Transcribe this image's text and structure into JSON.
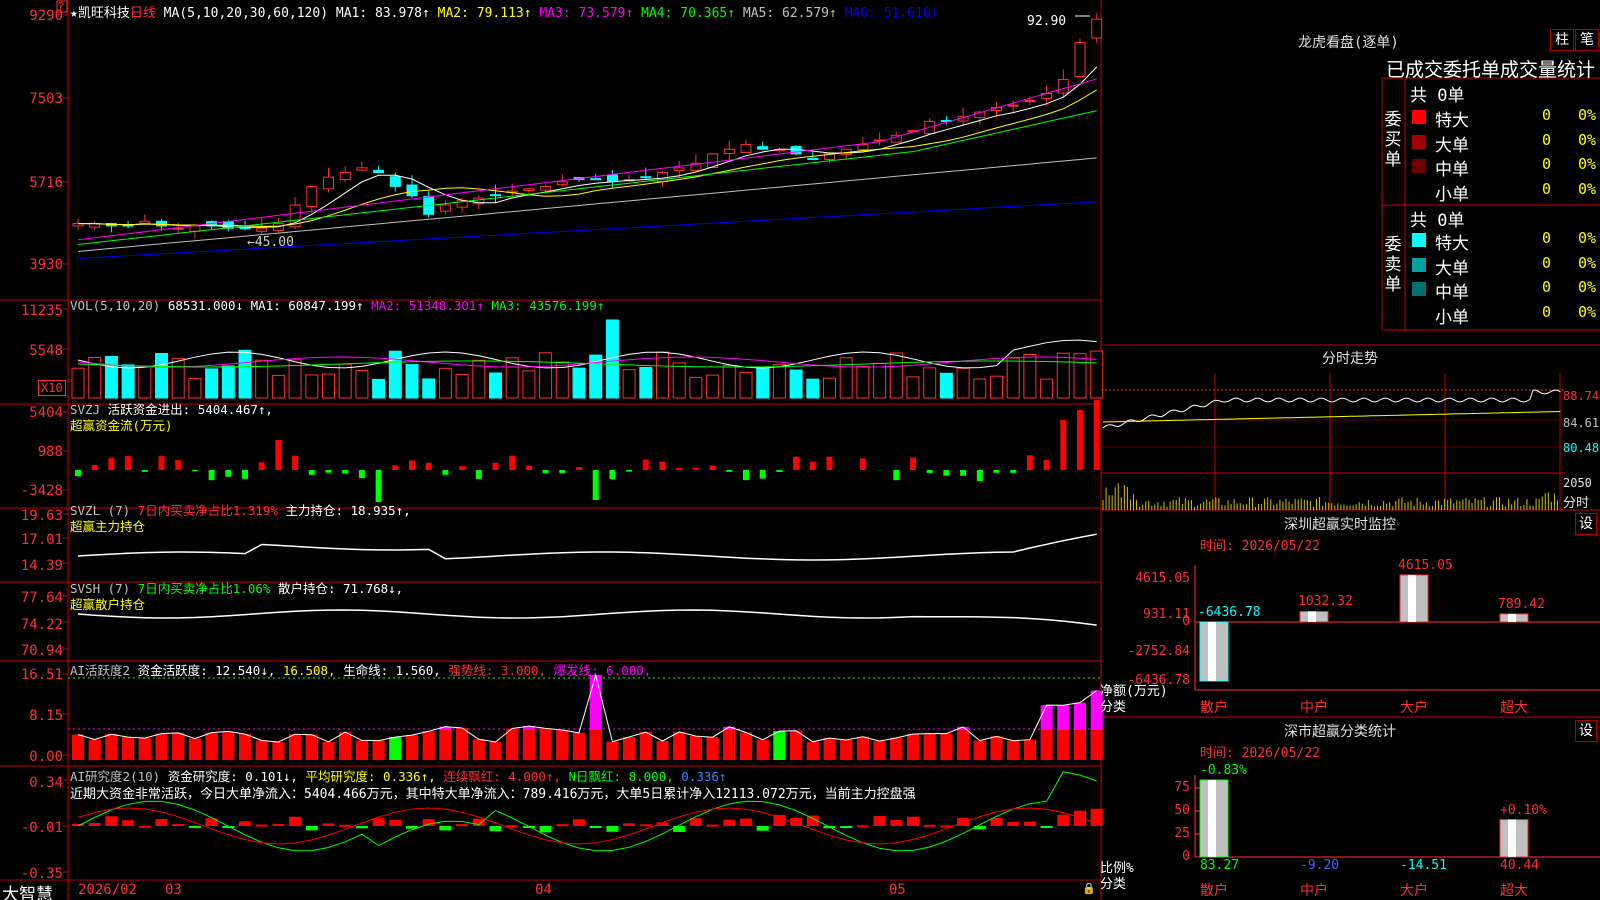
{
  "stock": {
    "title": "★凯旺科技",
    "period": "日线",
    "ma_params": "MA(5,10,20,30,60,120)",
    "ma": [
      {
        "label": "MA1: 83.978↑",
        "color": "#ffffff"
      },
      {
        "label": "MA2: 79.113↑",
        "color": "#ffff00"
      },
      {
        "label": "MA3: 73.579↑",
        "color": "#ff00ff"
      },
      {
        "label": "MA4: 70.365↑",
        "color": "#00ff00"
      },
      {
        "label": "MA5: 62.579↑",
        "color": "#c0c0c0"
      },
      {
        "label": "MA6: 51.616↑",
        "color": "#0000ff"
      }
    ],
    "high_label": "92.90",
    "low_label": "←45.00",
    "price_axis": [
      "9290",
      "7503",
      "5716",
      "3930"
    ],
    "corner_mark": "?"
  },
  "vol_panel": {
    "legend_name": "VOL(5,10,20)",
    "value": "68531.000↓",
    "ma1": "MA1: 60847.199↑",
    "ma2": "MA2: 51348.301↑",
    "ma3": "MA3: 43576.199↑",
    "axis": [
      "11235",
      "5548"
    ],
    "unit": "X10"
  },
  "svzj_panel": {
    "legend_name": "SVZJ",
    "line1": "活跃资金进出: 5404.467↑,",
    "line2": "超赢资金流(万元)",
    "axis": [
      "5404",
      "988",
      "-3428"
    ]
  },
  "svzl_panel": {
    "legend_name": "SVZL (7)",
    "ratio": "7日内买卖净占比1.319%",
    "hold": "主力持仓: 18.935↑,",
    "line2": "超赢主力持仓",
    "axis": [
      "19.63",
      "17.01",
      "14.39"
    ]
  },
  "svsh_panel": {
    "legend_name": "SVSH (7)",
    "ratio": "7日内买卖净占比1.06%",
    "hold": "散户持仓: 71.768↓,",
    "line2": "超赢散户持仓",
    "axis": [
      "77.64",
      "74.22",
      "70.94"
    ]
  },
  "ai_active_panel": {
    "legend_name": "AI活跃度2",
    "v1": "资金活跃度: 12.540↓,",
    "v2": "16.508,",
    "v3": "生命线: 1.560,",
    "v4": "强势线: 3.000,",
    "v5": "爆发线: 6.000,",
    "axis": [
      "16.51",
      "8.15",
      "0.00"
    ]
  },
  "ai_research_panel": {
    "legend_name": "AI研究度2(10)",
    "v1": "资金研究度: 0.101↓,",
    "v2": "平均研究度: 0.336↑,",
    "v3": "连续飘红: 4.000↑,",
    "v4": "N日飘红: 8.000,",
    "v5": "0.336↑",
    "comment": "近期大资金非常活跃，今日大单净流入：5404.466万元，其中特大单净流入：789.416万元，大单5日累计净入12113.072万元，当前主力控盘强",
    "axis": [
      "0.34",
      "-0.01",
      "-0.35"
    ]
  },
  "bottom_bar": {
    "brand": "大智慧",
    "dates": [
      "2026/02",
      "03",
      "04",
      "05"
    ]
  },
  "right": {
    "lhb_title": "龙虎看盘(逐单)",
    "btn_zhu": "柱",
    "btn_bi": "笔",
    "tabs_row": "已成交委托单成交量统计",
    "buy": {
      "side_label": "委买单",
      "total": "共 0单",
      "rows": [
        {
          "name": "特大",
          "count": "0",
          "pct": "0%",
          "color": "#ff0000"
        },
        {
          "name": "大单",
          "count": "0",
          "pct": "0%",
          "color": "#a00000"
        },
        {
          "name": "中单",
          "count": "0",
          "pct": "0%",
          "color": "#700000"
        },
        {
          "name": "小单",
          "count": "0",
          "pct": "0%",
          "color": "#000000"
        }
      ]
    },
    "sell": {
      "side_label": "委卖单",
      "total": "共 0单",
      "rows": [
        {
          "name": "特大",
          "count": "0",
          "pct": "0%",
          "color": "#00ffff"
        },
        {
          "name": "大单",
          "count": "0",
          "pct": "0%",
          "color": "#00a0a0"
        },
        {
          "name": "中单",
          "count": "0",
          "pct": "0%",
          "color": "#007070"
        },
        {
          "name": "小单",
          "count": "0",
          "pct": "0%",
          "color": "#000000"
        }
      ]
    },
    "intraday": {
      "title": "分时走势",
      "axis": [
        "88.74",
        "84.61",
        "80.48"
      ],
      "vol_label": "2050",
      "unit": "分时"
    },
    "sz_monitor": {
      "title": "深圳超赢实时监控",
      "setting": "设",
      "time": "时间: 2026/05/22",
      "axis": [
        "4615.05",
        "931.11",
        "0",
        "-2752.84",
        "-6436.78"
      ],
      "ylabel": "净额(万元)",
      "xlabel_head": "分类",
      "categories": [
        "散户",
        "中户",
        "大户",
        "超大"
      ],
      "values": [
        -6436.78,
        1032.32,
        4615.05,
        789.42
      ],
      "value_labels": [
        "-6436.78",
        "1032.32",
        "4615.05",
        "789.42"
      ]
    },
    "sz_class": {
      "title": "深市超赢分类统计",
      "setting": "设",
      "time": "时间: 2026/05/22",
      "axis": [
        "75",
        "50",
        "25",
        "0"
      ],
      "ylabel": "比例%",
      "xlabel_head": "分类",
      "categories": [
        "散户",
        "中户",
        "大户",
        "超大"
      ],
      "values": [
        83.27,
        -9.2,
        -14.51,
        40.44
      ],
      "value_labels": [
        "83.27",
        "-9.20",
        "-14.51",
        "40.44"
      ],
      "change_labels": [
        "-0.83%",
        "",
        "",
        "+0.10%"
      ]
    }
  }
}
